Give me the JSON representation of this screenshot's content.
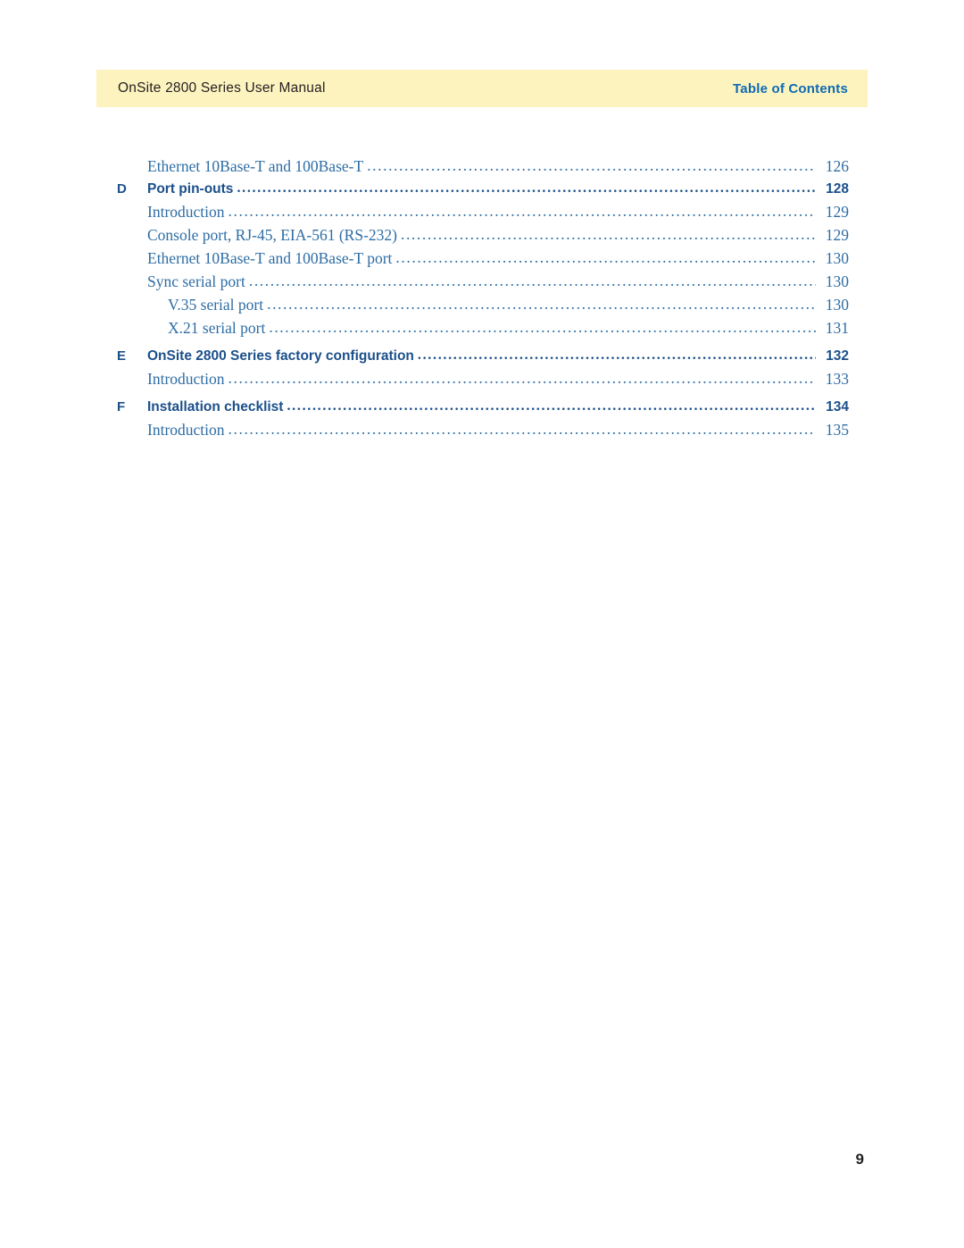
{
  "header": {
    "manual_title": "OnSite 2800 Series User Manual",
    "section_label": "Table of Contents"
  },
  "toc": {
    "entries": [
      {
        "letter": "",
        "indent": 1,
        "bold": false,
        "title": "Ethernet 10Base-T and 100Base-T",
        "page": "126",
        "gap_before": false
      },
      {
        "letter": "D",
        "indent": 0,
        "bold": true,
        "title": "Port pin-outs",
        "page": "128",
        "gap_before": false
      },
      {
        "letter": "",
        "indent": 1,
        "bold": false,
        "title": "Introduction",
        "page": "129",
        "gap_before": false
      },
      {
        "letter": "",
        "indent": 1,
        "bold": false,
        "title": "Console port, RJ-45, EIA-561 (RS-232)",
        "page": "129",
        "gap_before": false
      },
      {
        "letter": "",
        "indent": 1,
        "bold": false,
        "title": "Ethernet 10Base-T and 100Base-T port",
        "page": "130",
        "gap_before": false
      },
      {
        "letter": "",
        "indent": 1,
        "bold": false,
        "title": "Sync serial port",
        "page": "130",
        "gap_before": false
      },
      {
        "letter": "",
        "indent": 2,
        "bold": false,
        "title": "V.35 serial port",
        "page": "130",
        "gap_before": false
      },
      {
        "letter": "",
        "indent": 2,
        "bold": false,
        "title": "X.21 serial port",
        "page": "131",
        "gap_before": false
      },
      {
        "letter": "E",
        "indent": 0,
        "bold": true,
        "title": "OnSite 2800 Series factory configuration",
        "page": "132",
        "gap_before": true
      },
      {
        "letter": "",
        "indent": 1,
        "bold": false,
        "title": "Introduction",
        "page": "133",
        "gap_before": false
      },
      {
        "letter": "F",
        "indent": 0,
        "bold": true,
        "title": "Installation checklist",
        "page": "134",
        "gap_before": true
      },
      {
        "letter": "",
        "indent": 1,
        "bold": false,
        "title": "Introduction",
        "page": "135",
        "gap_before": false
      }
    ]
  },
  "footer": {
    "page_number": "9"
  }
}
